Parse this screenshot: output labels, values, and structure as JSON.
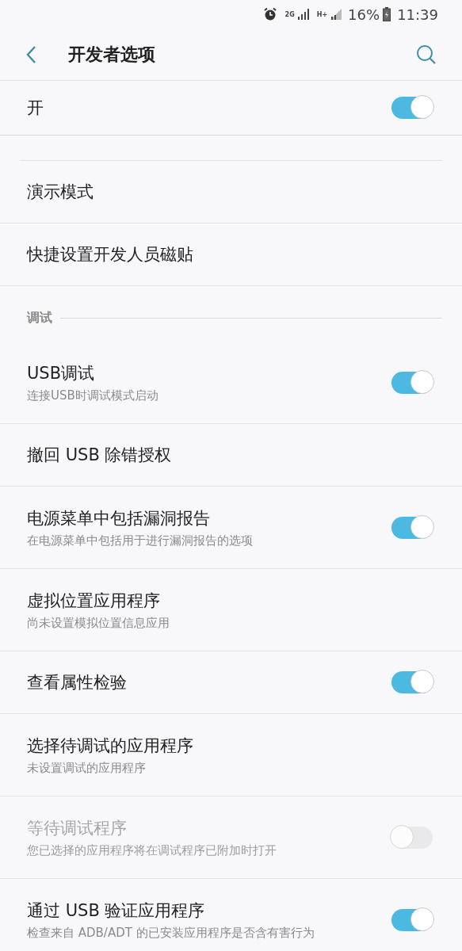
{
  "status_bar": {
    "network_1": "2G",
    "network_2": "H+",
    "battery": "16%",
    "time": "11:39"
  },
  "header": {
    "title": "开发者选项"
  },
  "master": {
    "label": "开",
    "on": true
  },
  "items": [
    {
      "kind": "plain",
      "title": "演示模式"
    },
    {
      "kind": "plain",
      "title": "快捷设置开发人员磁贴"
    },
    {
      "kind": "section",
      "title": "调试"
    },
    {
      "kind": "toggle",
      "title": "USB调试",
      "subtitle": "连接USB时调试模式启动",
      "on": true,
      "disabled": false
    },
    {
      "kind": "plain",
      "title": "撤回 USB 除错授权"
    },
    {
      "kind": "toggle",
      "title": "电源菜单中包括漏洞报告",
      "subtitle": "在电源菜单中包括用于进行漏洞报告的选项",
      "on": true,
      "disabled": false
    },
    {
      "kind": "plain",
      "title": "虚拟位置应用程序",
      "subtitle": "尚未设置模拟位置信息应用"
    },
    {
      "kind": "toggle",
      "title": "查看属性检验",
      "on": true,
      "disabled": false
    },
    {
      "kind": "plain",
      "title": "选择待调试的应用程序",
      "subtitle": "未设置调试的应用程序"
    },
    {
      "kind": "toggle",
      "title": "等待调试程序",
      "subtitle": "您已选择的应用程序将在调试程序已附加时打开",
      "on": false,
      "disabled": true
    },
    {
      "kind": "toggle",
      "title": "通过 USB 验证应用程序",
      "subtitle": "检查来自 ADB/ADT 的已安装应用程序是否含有害行为",
      "on": true,
      "disabled": false
    }
  ]
}
